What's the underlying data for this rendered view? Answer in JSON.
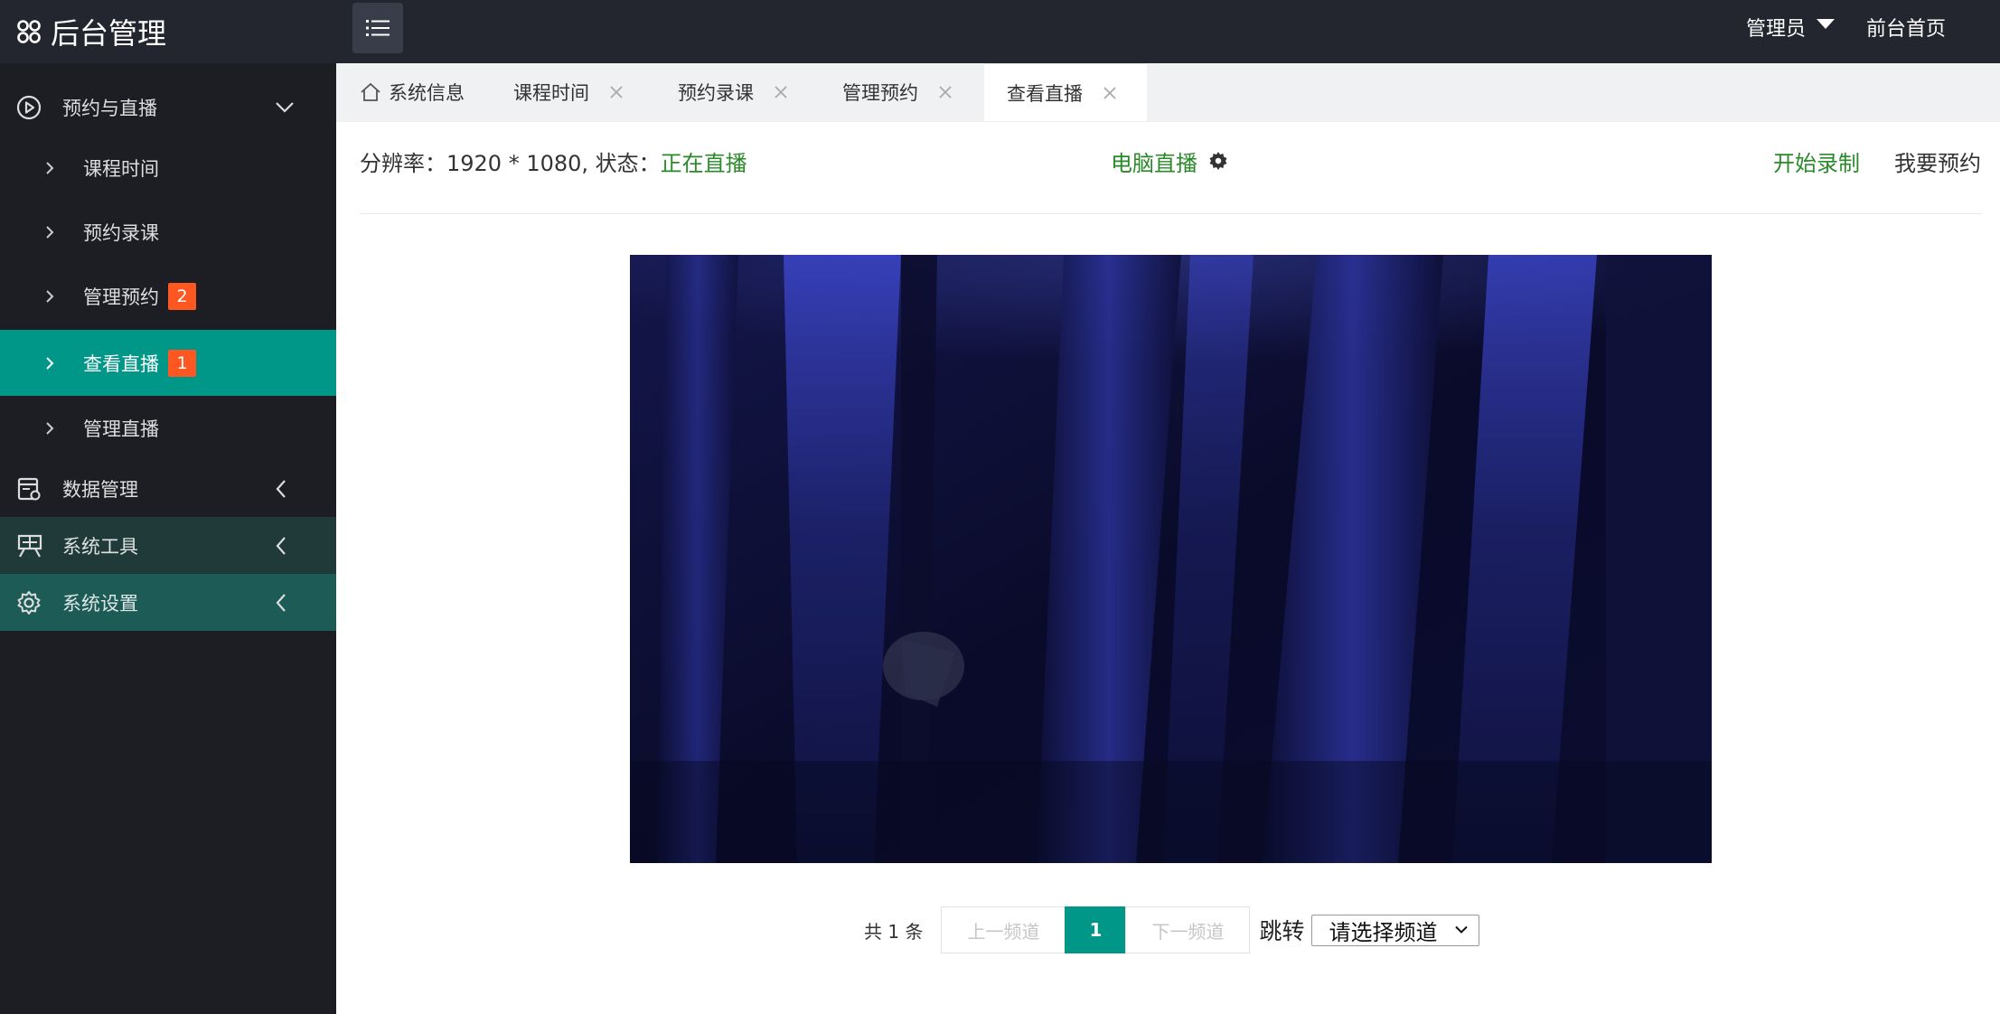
{
  "header": {
    "app_title": "后台管理",
    "admin_label": "管理员",
    "home_link": "前台首页"
  },
  "sidebar": {
    "groups": [
      {
        "label": "预约与直播",
        "icon": "play-circle-icon",
        "expanded": true
      },
      {
        "label": "数据管理",
        "icon": "data-icon",
        "expanded": false
      },
      {
        "label": "系统工具",
        "icon": "tools-icon",
        "expanded": false
      },
      {
        "label": "系统设置",
        "icon": "gear-icon",
        "expanded": false
      }
    ],
    "items": [
      {
        "label": "课程时间",
        "badge": ""
      },
      {
        "label": "预约录课",
        "badge": ""
      },
      {
        "label": "管理预约",
        "badge": "2"
      },
      {
        "label": "查看直播",
        "badge": "1",
        "active": true
      },
      {
        "label": "管理直播",
        "badge": ""
      }
    ]
  },
  "tabs": [
    {
      "label": "系统信息",
      "icon": "home-icon",
      "closable": false
    },
    {
      "label": "课程时间",
      "closable": true
    },
    {
      "label": "预约录课",
      "closable": true
    },
    {
      "label": "管理预约",
      "closable": true
    },
    {
      "label": "查看直播",
      "closable": true,
      "active": true
    }
  ],
  "live": {
    "resolution_prefix": "分辨率：1920 * 1080, 状态：",
    "status": "正在直播",
    "pc_live": "电脑直播",
    "start_record": "开始录制",
    "book": "我要预约"
  },
  "pager": {
    "total": "共 1 条",
    "prev": "上一频道",
    "current": "1",
    "next": "下一频道",
    "jump_label": "跳转",
    "select_value": "请选择频道"
  },
  "colors": {
    "accent": "#009688",
    "badge": "#ff5722",
    "status_green": "#2a8a2a",
    "sidebar_bg": "#1c1e23",
    "topbar_bg": "#23262e"
  }
}
